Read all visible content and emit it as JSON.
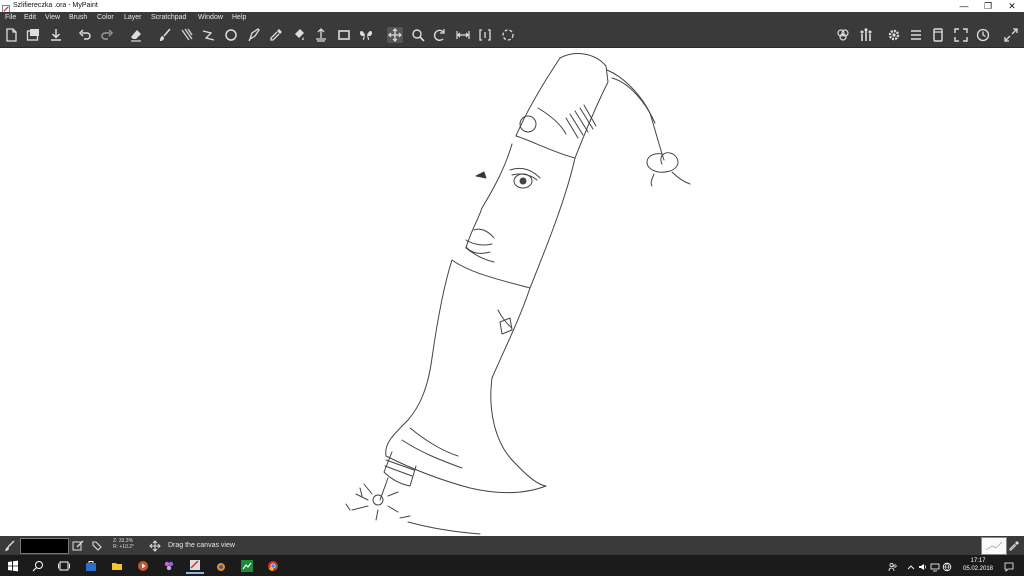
{
  "window": {
    "title": "Szlifiereczka .ora - MyPaint",
    "minimize_label": "—",
    "restore_label": "❐",
    "close_label": "✕"
  },
  "menu": [
    "File",
    "Edit",
    "View",
    "Brush",
    "Color",
    "Layer",
    "Scratchpad",
    "Window",
    "Help"
  ],
  "toolbar": {
    "left": [
      "new-icon",
      "save-icon",
      "export-icon",
      "undo-icon",
      "redo-icon",
      "eraser-icon",
      "brush-icon",
      "multi-brush-icon",
      "line-tool-icon",
      "ellipse-tool-icon",
      "inking-tool-icon",
      "color-picker-icon",
      "fill-icon",
      "layer-move-icon",
      "frame-icon",
      "symmetry-icon",
      "pan-icon",
      "zoom-icon",
      "rotate-icon",
      "mirror-icon",
      "fit-icon",
      "reset-view-icon"
    ],
    "right": [
      "color-palette-icon",
      "brush-presets-icon",
      "settings-icon",
      "layers-icon",
      "scratchpad-icon",
      "fullscreen-icon",
      "history-icon",
      "expand-icon"
    ],
    "active": "pan-icon"
  },
  "status": {
    "current_color": "#000000",
    "zoom_line1": "Z: 33.3%",
    "zoom_line2": "R: +10.2°",
    "message": "Drag the canvas view"
  },
  "taskbar": {
    "apps": [
      "start-icon",
      "search-icon",
      "task-view-icon",
      "store-icon",
      "file-explorer-icon",
      "media-player-icon",
      "paint-app-icon",
      "mypaint-icon",
      "blender-icon",
      "steam-icon",
      "chrome-icon"
    ],
    "running": [
      "mypaint-icon"
    ],
    "time": "17:17",
    "date": "05.02.2018"
  }
}
